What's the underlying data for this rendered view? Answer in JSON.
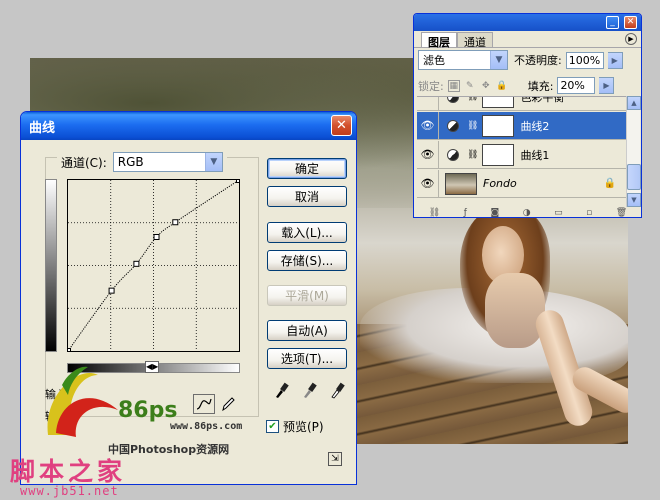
{
  "curves_dialog": {
    "title": "曲线",
    "channel_label": "通道(C):",
    "channel_value": "RGB",
    "input_label": "输入",
    "output_label": "输出",
    "buttons": {
      "ok": "确定",
      "cancel": "取消",
      "load": "载入(L)...",
      "save": "存储(S)...",
      "smooth": "平滑(M)",
      "auto": "自动(A)",
      "options": "选项(T)..."
    },
    "preview_label": "预览(P)",
    "preview_checked": true,
    "curve_points": [
      {
        "input": 0,
        "output": 0
      },
      {
        "input": 65,
        "output": 90
      },
      {
        "input": 102,
        "output": 130
      },
      {
        "input": 132,
        "output": 170
      },
      {
        "input": 160,
        "output": 192
      },
      {
        "input": 255,
        "output": 255
      }
    ]
  },
  "layers_panel": {
    "tabs": [
      "图层",
      "通道"
    ],
    "blend_mode": "滤色",
    "opacity_label": "不透明度:",
    "opacity_value": "100%",
    "lock_label": "锁定:",
    "fill_label": "填充:",
    "fill_value": "20%",
    "layers": [
      {
        "name": "色彩平衡",
        "type": "adjustment",
        "visible": false,
        "selected": false
      },
      {
        "name": "曲线2",
        "type": "adjustment",
        "visible": true,
        "selected": true
      },
      {
        "name": "曲线1",
        "type": "adjustment",
        "visible": true,
        "selected": false
      },
      {
        "name": "Fondo",
        "type": "image",
        "visible": true,
        "selected": false,
        "locked": true
      }
    ]
  },
  "watermark": {
    "logo_number": "86ps",
    "url": "www.86ps.com",
    "site_name_cn": "中国Photoshop资源网",
    "jb51_text": "脚本之家",
    "jb51_url": "www.jb51.net"
  },
  "colors": {
    "xp_title_blue": "#1c6df0",
    "selection_blue": "#316ac5",
    "dialog_bg": "#ece9d8"
  }
}
